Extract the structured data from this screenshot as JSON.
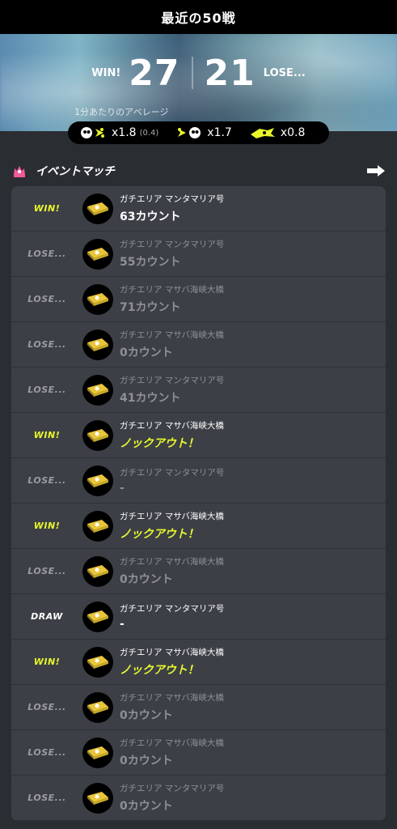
{
  "header": {
    "title": "最近の50戦"
  },
  "summary": {
    "win_label": "WIN!",
    "win_count": "27",
    "lose_count": "21",
    "lose_label": "LOSE...",
    "avg_label": "1分あたりのアベレージ",
    "kill": "x1.8",
    "kill_sub": "(0.4)",
    "death": "x1.7",
    "special": "x0.8"
  },
  "section": {
    "title": "イベントマッチ"
  },
  "matches": [
    {
      "result": "WIN!",
      "type": "win",
      "stage": "ガチエリア マンタマリア号",
      "count": "63カウント"
    },
    {
      "result": "LOSE...",
      "type": "lose",
      "stage": "ガチエリア マンタマリア号",
      "count": "55カウント"
    },
    {
      "result": "LOSE...",
      "type": "lose",
      "stage": "ガチエリア マサバ海峡大橋",
      "count": "71カウント"
    },
    {
      "result": "LOSE...",
      "type": "lose",
      "stage": "ガチエリア マサバ海峡大橋",
      "count": "0カウント"
    },
    {
      "result": "LOSE...",
      "type": "lose",
      "stage": "ガチエリア マンタマリア号",
      "count": "41カウント"
    },
    {
      "result": "WIN!",
      "type": "win",
      "stage": "ガチエリア マサバ海峡大橋",
      "count": "ノックアウト！"
    },
    {
      "result": "LOSE...",
      "type": "lose",
      "stage": "ガチエリア マンタマリア号",
      "count": "-"
    },
    {
      "result": "WIN!",
      "type": "win",
      "stage": "ガチエリア マサバ海峡大橋",
      "count": "ノックアウト！"
    },
    {
      "result": "LOSE...",
      "type": "lose",
      "stage": "ガチエリア マサバ海峡大橋",
      "count": "0カウント"
    },
    {
      "result": "DRAW",
      "type": "draw",
      "stage": "ガチエリア マンタマリア号",
      "count": "-"
    },
    {
      "result": "WIN!",
      "type": "win",
      "stage": "ガチエリア マサバ海峡大橋",
      "count": "ノックアウト！"
    },
    {
      "result": "LOSE...",
      "type": "lose",
      "stage": "ガチエリア マサバ海峡大橋",
      "count": "0カウント"
    },
    {
      "result": "LOSE...",
      "type": "lose",
      "stage": "ガチエリア マサバ海峡大橋",
      "count": "0カウント"
    },
    {
      "result": "LOSE...",
      "type": "lose",
      "stage": "ガチエリア マンタマリア号",
      "count": "0カウント"
    }
  ],
  "colors": {
    "win": "#e9f72c",
    "lose": "#9a9ca0",
    "draw": "#ffffff",
    "accent": "#e9f72c"
  }
}
